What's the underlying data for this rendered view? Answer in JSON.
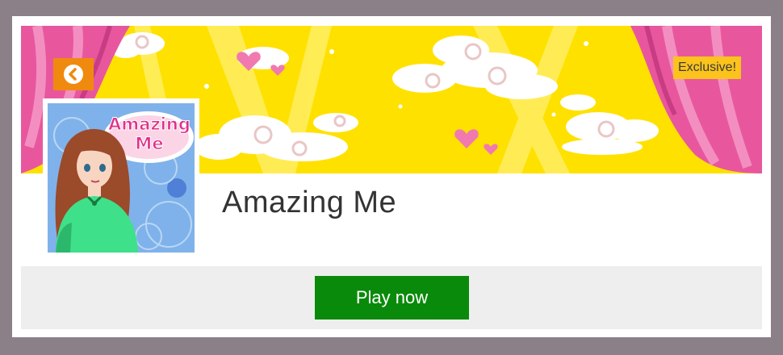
{
  "game": {
    "title": "Amazing Me",
    "badge": "Exclusive!",
    "play_label": "Play now",
    "logo_line1": "Amazing",
    "logo_line2": "Me"
  },
  "icons": {
    "back": "chevron-left-icon"
  },
  "colors": {
    "background": "#8c8088",
    "banner_yellow": "#ffe100",
    "curtain_pink": "#e8579e",
    "back_button": "#f08a0e",
    "badge": "#fbc31b",
    "play_button": "#0a8a0a",
    "play_area": "#eeeeee"
  }
}
